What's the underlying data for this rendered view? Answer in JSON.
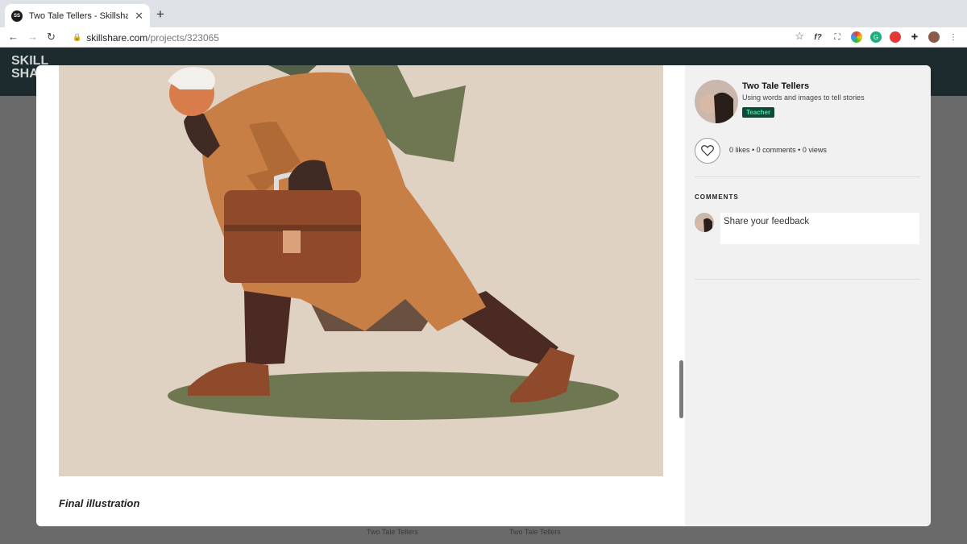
{
  "browser": {
    "tab_title": "Two Tale Tellers - Skillshare",
    "favicon_text": "SS",
    "url_host": "skillshare.com",
    "url_path": "/projects/323065",
    "icons": [
      "back-icon",
      "forward-icon",
      "reload-icon",
      "lock-icon",
      "star-icon",
      "extensions-icon",
      "profile-icon",
      "menu-icon"
    ]
  },
  "site": {
    "logo": "SKILL SHARE"
  },
  "modal": {
    "caption": "Final illustration",
    "author": {
      "name": "Two Tale Tellers",
      "tagline": "Using words and images to tell stories",
      "badge": "Teacher"
    },
    "stats": "0 likes • 0 comments • 0 views",
    "comments_heading": "COMMENTS",
    "comment_placeholder": "Share your feedback"
  },
  "background_cards": [
    "Two Tale Tellers",
    "Two Tale Tellers"
  ],
  "colors": {
    "badge_bg": "#0e4a3a",
    "badge_text": "#3fe3a0",
    "illustration_bg": "#dfd2c2",
    "coat": "#c87f45",
    "shadow": "#6f7752"
  }
}
